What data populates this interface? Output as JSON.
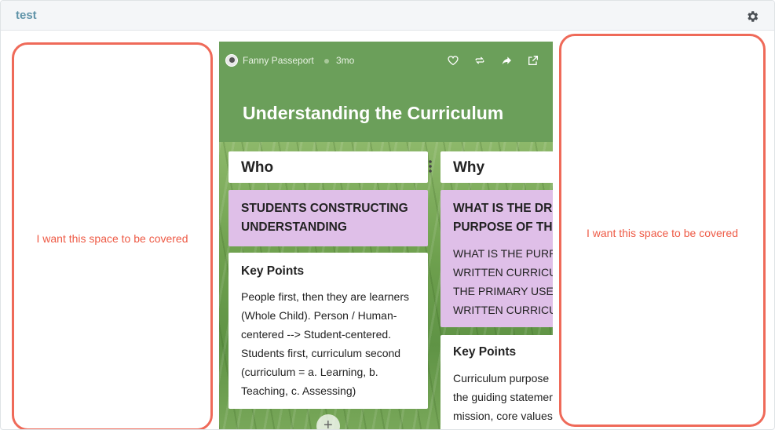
{
  "window": {
    "title": "test",
    "settings_icon": "gear-icon"
  },
  "left_note": {
    "text": "I want this space to be covered"
  },
  "right_note": {
    "text": "I want this space to be covered"
  },
  "padlet": {
    "author": "Fanny Passeport",
    "time_ago": "3mo",
    "title": "Understanding the Curriculum",
    "header_color": "#6b9f5a",
    "actions": [
      "heart-icon",
      "repost-icon",
      "share-icon",
      "open-external-icon"
    ],
    "columns": [
      {
        "heading": "Who",
        "cards": [
          {
            "type": "purple",
            "lines": [
              "STUDENTS CONSTRUCTING",
              "UNDERSTANDING"
            ]
          },
          {
            "type": "white",
            "title": "Key Points",
            "lines": [
              "People first, then they are learners",
              "(Whole Child). Person / Human-",
              "centered --> Student-centered.",
              "Students first, curriculum second",
              "(curriculum = a. Learning, b.",
              "Teaching, c. Assessing)"
            ]
          }
        ],
        "add_label": "+"
      },
      {
        "heading": "Why",
        "cards": [
          {
            "type": "purple",
            "lines": [
              "WHAT IS THE DRI",
              "PURPOSE OF THE"
            ],
            "body": [
              "WHAT IS THE PURPO",
              "WRITTEN CURRICUL",
              "THE PRIMARY USER",
              "WRITTEN CURRICUL"
            ]
          },
          {
            "type": "white",
            "title": "Key Points",
            "lines": [
              "Curriculum purpose",
              "the guiding statemer",
              "mission, core values"
            ]
          }
        ]
      }
    ]
  }
}
